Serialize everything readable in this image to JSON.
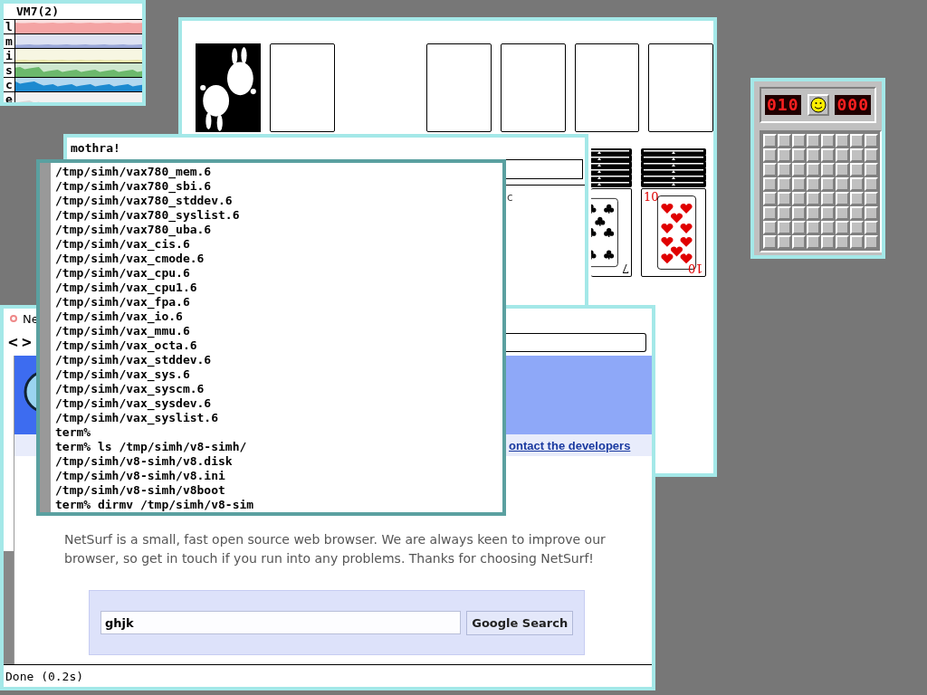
{
  "stats_window": {
    "title": "VM7(2)",
    "rows": [
      {
        "label": "l",
        "color": "#f4a4a4"
      },
      {
        "label": "m",
        "color": "#9aa8d8"
      },
      {
        "label": "i",
        "color": "#e8e4a8"
      },
      {
        "label": "s",
        "color": "#6cb86c"
      },
      {
        "label": "c",
        "color": "#1c8ad0"
      },
      {
        "label": "e",
        "color": "#d8d8d8"
      }
    ]
  },
  "solitaire": {
    "tableau": [
      {
        "kind": "clubs",
        "bottom_rank": "7"
      },
      {
        "kind": "hearts",
        "top_rank": "10",
        "bottom_rank": "10"
      }
    ]
  },
  "mothra": {
    "title": "mothra!",
    "text": "c"
  },
  "browser": {
    "tab_title": "Ne",
    "back": "<",
    "forward": ">",
    "links": [
      "ontact the developers"
    ],
    "paragraph": "NetSurf is a small, fast open source web browser. We are always keen to improve our browser, so get in touch if you run into any problems. Thanks for choosing NetSurf!",
    "search": {
      "value": "ghjk",
      "button": "Google Search"
    },
    "status": "Done (0.2s)"
  },
  "terminal": {
    "lines": [
      "/tmp/simh/vax780_mem.6",
      "/tmp/simh/vax780_sbi.6",
      "/tmp/simh/vax780_stddev.6",
      "/tmp/simh/vax780_syslist.6",
      "/tmp/simh/vax780_uba.6",
      "/tmp/simh/vax_cis.6",
      "/tmp/simh/vax_cmode.6",
      "/tmp/simh/vax_cpu.6",
      "/tmp/simh/vax_cpu1.6",
      "/tmp/simh/vax_fpa.6",
      "/tmp/simh/vax_io.6",
      "/tmp/simh/vax_mmu.6",
      "/tmp/simh/vax_octa.6",
      "/tmp/simh/vax_stddev.6",
      "/tmp/simh/vax_sys.6",
      "/tmp/simh/vax_syscm.6",
      "/tmp/simh/vax_sysdev.6",
      "/tmp/simh/vax_syslist.6",
      "term%",
      "term% ls /tmp/simh/v8-simh/",
      "/tmp/simh/v8-simh/v8.disk",
      "/tmp/simh/v8-simh/v8.ini",
      "/tmp/simh/v8-simh/v8boot",
      "term% dirmv /tmp/simh/v8-sim"
    ]
  },
  "minesweeper": {
    "mines": "010",
    "time": "000"
  }
}
